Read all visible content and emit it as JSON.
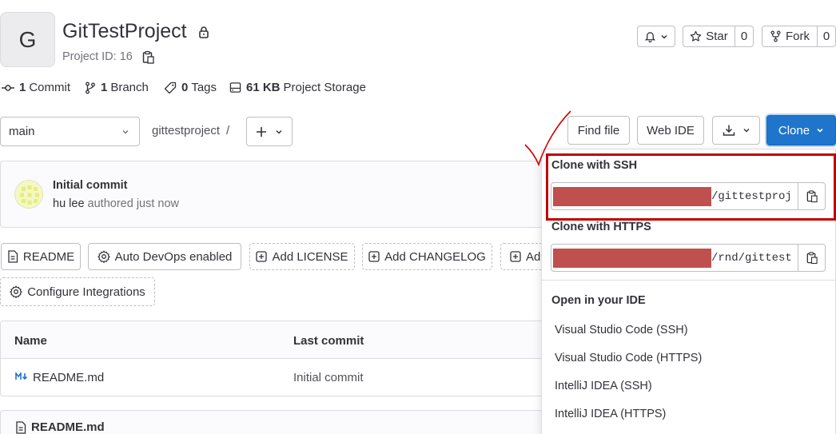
{
  "project": {
    "avatar_letter": "G",
    "name": "GitTestProject",
    "id_label": "Project ID: 16"
  },
  "header_actions": {
    "star_label": "Star",
    "star_count": "0",
    "fork_label": "Fork",
    "fork_count": "0"
  },
  "stats": {
    "commits_count": "1",
    "commits_label": "Commit",
    "branches_count": "1",
    "branches_label": "Branch",
    "tags_count": "0",
    "tags_label": "Tags",
    "storage_size": "61 KB",
    "storage_label": "Project Storage"
  },
  "toolbar": {
    "branch": "main",
    "path": "gittestproject",
    "path_sep": "/",
    "find_file": "Find file",
    "web_ide": "Web IDE",
    "clone": "Clone"
  },
  "commit": {
    "title": "Initial commit",
    "author": "hu lee",
    "meta": "authored just now"
  },
  "quick_actions": [
    "README",
    "Auto DevOps enabled",
    "Add LICENSE",
    "Add CHANGELOG",
    "Ad",
    "Configure Integrations"
  ],
  "file_table": {
    "col_name": "Name",
    "col_last_commit": "Last commit",
    "rows": [
      {
        "name": "README.md",
        "commit": "Initial commit"
      }
    ]
  },
  "readme_title": "README.md",
  "clone_dropdown": {
    "ssh_title": "Clone with SSH",
    "ssh_url_tail": "/gittestproj",
    "https_title": "Clone with HTTPS",
    "https_url_tail": "/rnd/gittest",
    "ide_title": "Open in your IDE",
    "ide_items": [
      "Visual Studio Code (SSH)",
      "Visual Studio Code (HTTPS)",
      "IntelliJ IDEA (SSH)",
      "IntelliJ IDEA (HTTPS)"
    ]
  },
  "colors": {
    "accent": "#1f75cb",
    "annotation": "#c00000",
    "redaction": "#c0504d"
  }
}
